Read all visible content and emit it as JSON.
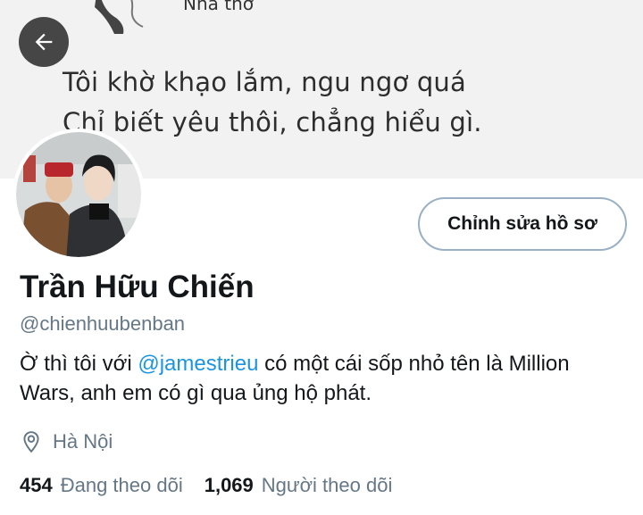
{
  "banner": {
    "caption": "Nhà thơ",
    "line1": "Tôi khờ khạo lắm, ngu ngơ quá",
    "line2": "Chỉ biết yêu thôi, chẳng hiểu gì."
  },
  "header": {
    "back_icon": "arrow-left-icon"
  },
  "profile": {
    "edit_label": "Chỉnh sửa hồ sơ",
    "name": "Trần Hữu Chiến",
    "handle": "@chienhuubenban",
    "bio_part1": "Ờ thì tôi với ",
    "bio_mention": "@jamestrieu",
    "bio_part2": " có một cái sốp nhỏ tên là Million Wars, anh em có gì qua ủng hộ phát.",
    "location_icon": "map-pin-icon",
    "location": "Hà Nội"
  },
  "stats": {
    "following_count": "454",
    "following_label": "Đang theo dõi",
    "followers_count": "1,069",
    "followers_label": "Người theo dõi"
  },
  "colors": {
    "link": "#1b95e0",
    "secondary_text": "#657786",
    "button_border": "#9ab0c4"
  }
}
